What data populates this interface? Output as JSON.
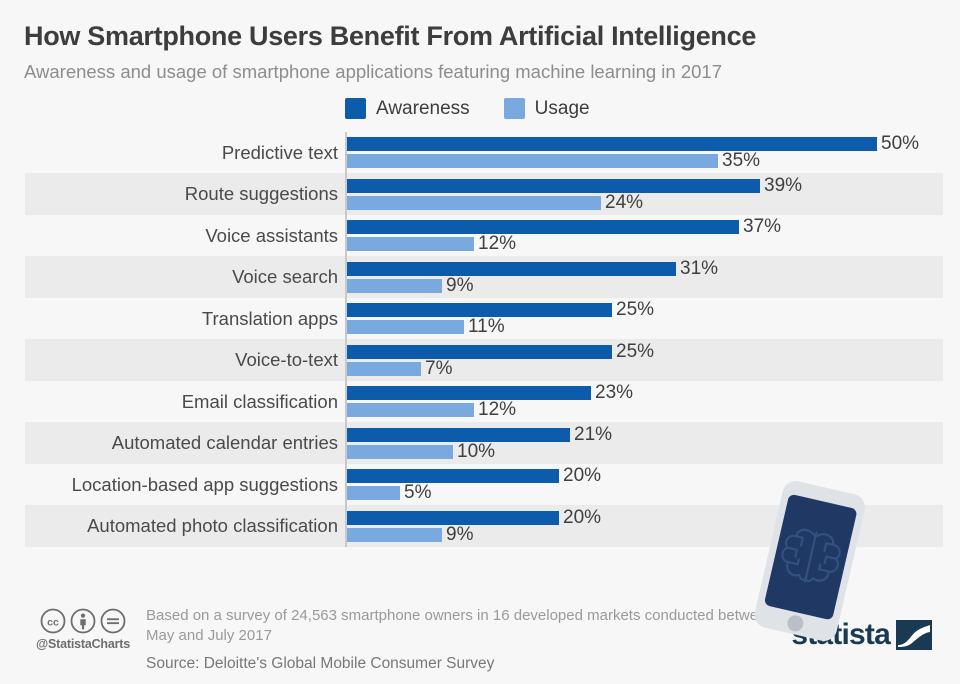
{
  "header": {
    "title": "How Smartphone Users Benefit From Artificial Intelligence",
    "subtitle": "Awareness and usage of smartphone applications featuring machine learning in 2017"
  },
  "legend": {
    "items": [
      {
        "label": "Awareness",
        "color": "#0d5cab"
      },
      {
        "label": "Usage",
        "color": "#7aa9e0"
      }
    ]
  },
  "footer": {
    "note": "Based on a survey of 24,563 smartphone owners in 16 developed markets conducted between May and July 2017",
    "source": "Source: Deloitte's Global Mobile Consumer Survey",
    "handle": "@StatistaCharts",
    "logo": "statista"
  },
  "chart_data": {
    "type": "bar",
    "orientation": "horizontal",
    "title": "How Smartphone Users Benefit From Artificial Intelligence",
    "subtitle": "Awareness and usage of smartphone applications featuring machine learning in 2017",
    "xlabel": "",
    "ylabel": "",
    "xlim": [
      0,
      50
    ],
    "grid": false,
    "legend_position": "top",
    "value_suffix": "%",
    "categories": [
      "Predictive text",
      "Route suggestions",
      "Voice assistants",
      "Voice search",
      "Translation apps",
      "Voice-to-text",
      "Email classification",
      "Automated calendar entries",
      "Location-based app suggestions",
      "Automated photo classification"
    ],
    "series": [
      {
        "name": "Awareness",
        "color": "#0d5cab",
        "values": [
          50,
          39,
          37,
          31,
          25,
          25,
          23,
          21,
          20,
          20
        ],
        "labels": [
          "50%",
          "39%",
          "37%",
          "31%",
          "25%",
          "25%",
          "23%",
          "21%",
          "20%",
          "20%"
        ]
      },
      {
        "name": "Usage",
        "color": "#7aa9e0",
        "values": [
          35,
          24,
          12,
          9,
          11,
          7,
          12,
          10,
          5,
          9
        ],
        "labels": [
          "35%",
          "24%",
          "12%",
          "9%",
          "11%",
          "7%",
          "12%",
          "10%",
          "5%",
          "9%"
        ]
      }
    ]
  }
}
